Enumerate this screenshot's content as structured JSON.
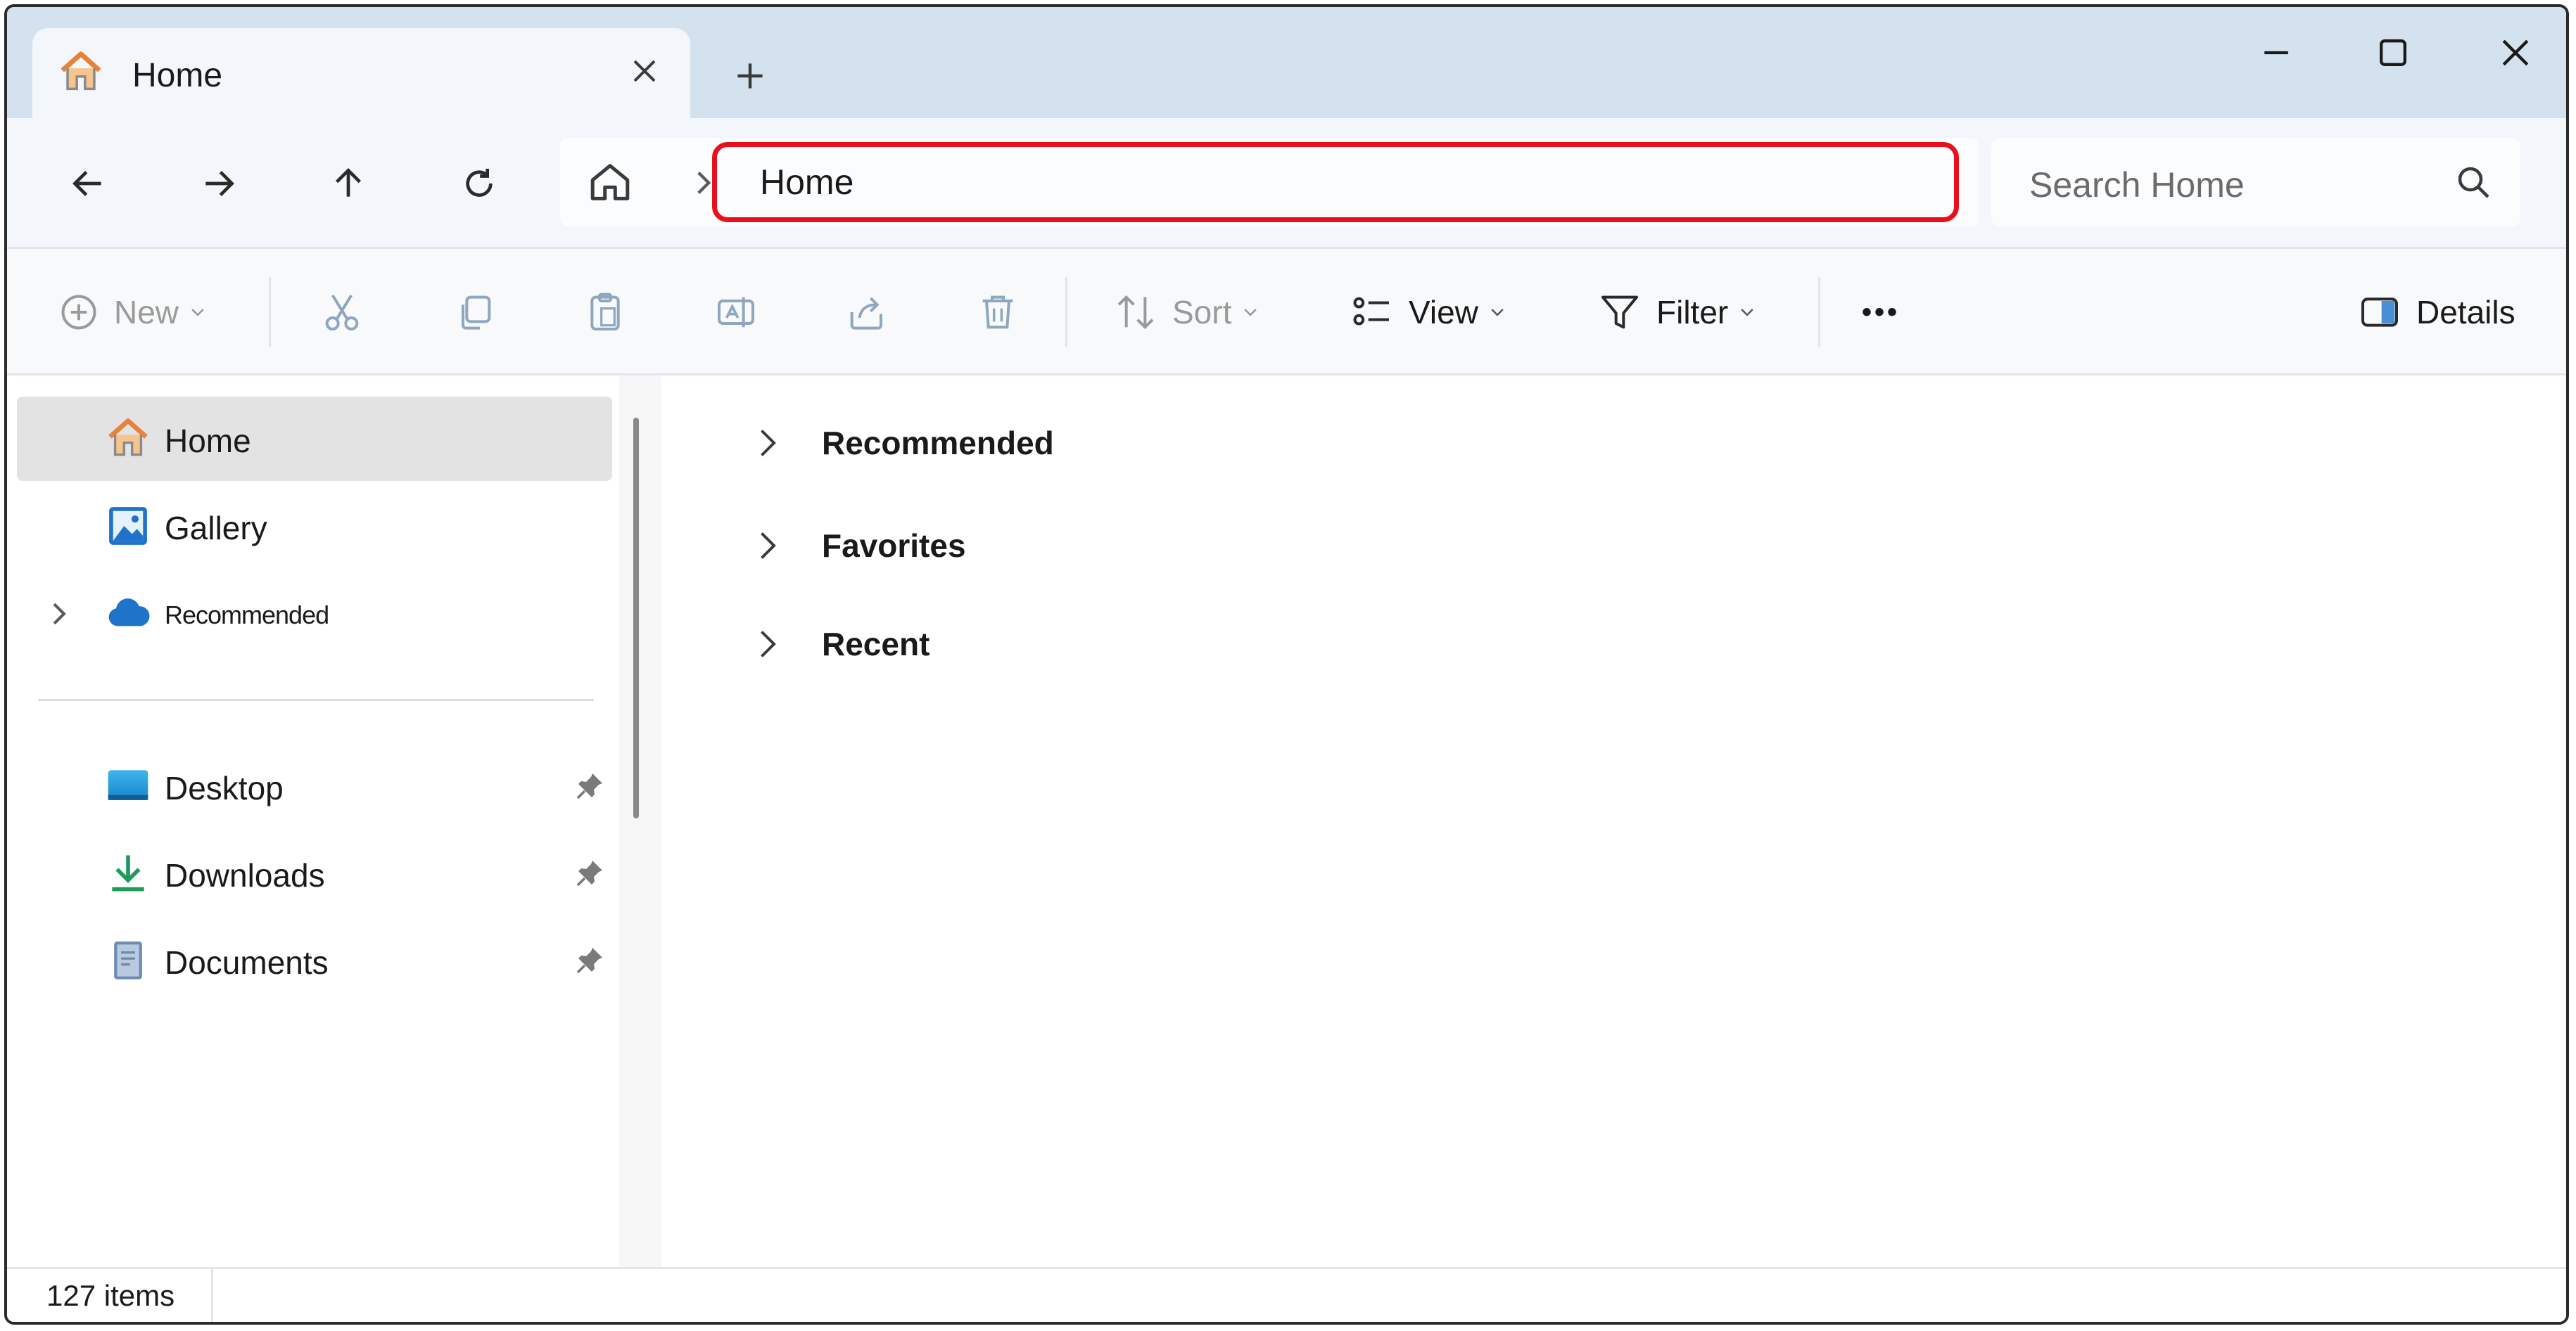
{
  "window": {
    "tab_title": "Home",
    "colors": {
      "titlebar": "#d4e2ef",
      "accent_highlight": "#e8101b",
      "home_icon": "#e8823a"
    }
  },
  "toolbar_icons": {
    "back": "arrow-left-icon",
    "forward": "arrow-right-icon",
    "up": "arrow-up-icon",
    "refresh": "refresh-icon"
  },
  "address": {
    "path": "Home"
  },
  "search": {
    "placeholder": "Search Home"
  },
  "commands": {
    "new": "New",
    "sort": "Sort",
    "view": "View",
    "filter": "Filter",
    "more": "•••",
    "details": "Details"
  },
  "sidebar": {
    "items": [
      {
        "label": "Home",
        "icon": "home-icon",
        "selected": true
      },
      {
        "label": "Gallery",
        "icon": "gallery-icon"
      },
      {
        "label": "Recommended",
        "icon": "cloud-icon",
        "expandable": true
      }
    ],
    "pinned": [
      {
        "label": "Desktop",
        "icon": "desktop-icon"
      },
      {
        "label": "Downloads",
        "icon": "download-icon"
      },
      {
        "label": "Documents",
        "icon": "documents-icon"
      }
    ]
  },
  "content": {
    "sections": [
      {
        "label": "Recommended"
      },
      {
        "label": "Favorites"
      },
      {
        "label": "Recent"
      }
    ]
  },
  "status": {
    "items_count": "127 items"
  }
}
